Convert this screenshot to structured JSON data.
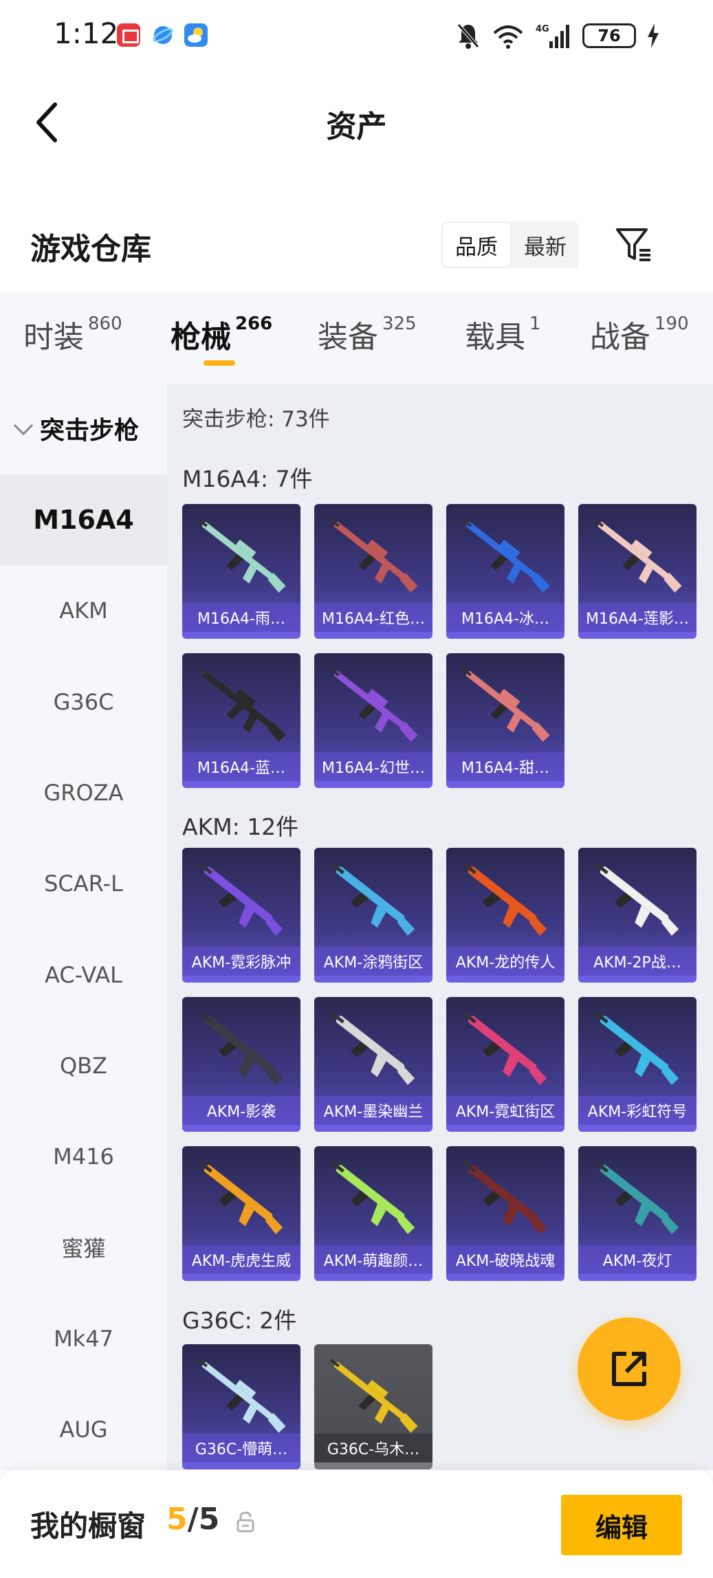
{
  "status_bar": {
    "time": "1:12",
    "battery": "76"
  },
  "header": {
    "title": "资产"
  },
  "section": {
    "title": "游戏仓库",
    "sort_options": [
      "品质",
      "最新"
    ],
    "active_sort": 0
  },
  "tabs": [
    {
      "label": "时装",
      "count": "860"
    },
    {
      "label": "枪械",
      "count": "266"
    },
    {
      "label": "装备",
      "count": "325"
    },
    {
      "label": "载具",
      "count": "1"
    },
    {
      "label": "战备",
      "count": "190"
    }
  ],
  "sidebar": {
    "group": "突击步枪",
    "items": [
      "M16A4",
      "AKM",
      "G36C",
      "GROZA",
      "SCAR-L",
      "AC-VAL",
      "QBZ",
      "M416",
      "蜜獾",
      "Mk47",
      "AUG"
    ]
  },
  "content": {
    "category_header": "突击步枪: 73件",
    "groups": [
      {
        "title": "M16A4: 7件",
        "items": [
          "M16A4-雨…",
          "M16A4-红色…",
          "M16A4-冰…",
          "M16A4-莲影…",
          "M16A4-蓝…",
          "M16A4-幻世…",
          "M16A4-甜…"
        ]
      },
      {
        "title": "AKM: 12件",
        "items": [
          "AKM-霓彩脉冲",
          "AKM-涂鸦街区",
          "AKM-龙的传人",
          "AKM-2P战…",
          "AKM-影袭",
          "AKM-墨染幽兰",
          "AKM-霓虹街区",
          "AKM-彩虹符号",
          "AKM-虎虎生威",
          "AKM-萌趣颜…",
          "AKM-破晓战魂",
          "AKM-夜灯"
        ]
      },
      {
        "title": "G36C: 2件",
        "items": [
          "G36C-懵萌…",
          "G36C-乌木…"
        ]
      }
    ]
  },
  "gun_colors": [
    "#9fd9c8",
    "#c0585a",
    "#2f6be0",
    "#f2c8c2",
    "#2a2a2a",
    "#8d4fd8",
    "#e07a78",
    "#7b4fe0",
    "#49b0e8",
    "#e8581e",
    "#f0f0f0",
    "#3b3b48",
    "#d8d8d8",
    "#e0407a",
    "#3dbae8",
    "#f0a020",
    "#a8e85a",
    "#7a2a2a",
    "#3aa0a8",
    "#bfe0f0",
    "#e8c020"
  ],
  "bottom_bar": {
    "title": "我的橱窗",
    "current": "5",
    "total": "/5",
    "edit_label": "编辑"
  }
}
